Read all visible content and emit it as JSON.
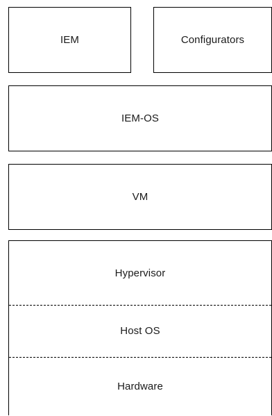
{
  "diagram": {
    "top_row": {
      "iem": "IEM",
      "configurators": "Configurators"
    },
    "iem_os": "IEM-OS",
    "vm": "VM",
    "host_stack": {
      "hypervisor": "Hypervisor",
      "host_os": "Host OS",
      "hardware": "Hardware"
    },
    "colors": {
      "border": "#000000",
      "background": "#ffffff",
      "text": "#1a1a1a"
    }
  }
}
